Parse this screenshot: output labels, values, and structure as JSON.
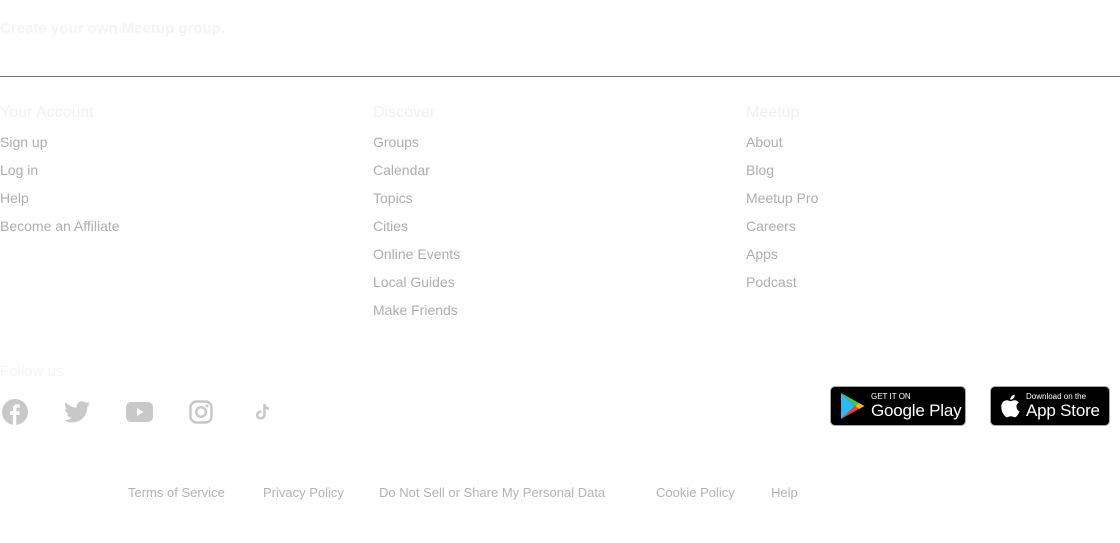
{
  "footer": {
    "create_group_label": "Create your own Meetup group.",
    "columns": [
      {
        "heading": "Your Account",
        "links": [
          "Sign up",
          "Log in",
          "Help",
          "Become an Affiliate"
        ]
      },
      {
        "heading": "Discover",
        "links": [
          "Groups",
          "Calendar",
          "Topics",
          "Cities",
          "Online Events",
          "Local Guides",
          "Make Friends"
        ]
      },
      {
        "heading": "Meetup",
        "links": [
          "About",
          "Blog",
          "Meetup Pro",
          "Careers",
          "Apps",
          "Podcast"
        ]
      }
    ],
    "follow_label": "Follow us",
    "social_icons": [
      "facebook-icon",
      "twitter-icon",
      "youtube-icon",
      "instagram-icon",
      "tiktok-icon"
    ],
    "google_play": {
      "small": "GET IT ON",
      "large": "Google Play"
    },
    "app_store": {
      "small": "Download on the",
      "large": "App Store"
    },
    "legal_links": [
      "Terms of Service",
      "Privacy Policy",
      "Do Not Sell or Share My Personal Data",
      "Cookie Policy",
      "Help"
    ],
    "colors": {
      "link": "#aeaeae",
      "icon": "#c8c8c8",
      "divider": "#707070"
    }
  }
}
